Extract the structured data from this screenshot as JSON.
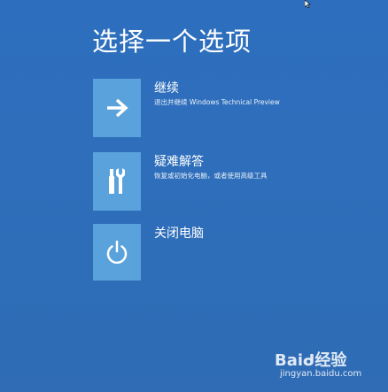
{
  "page": {
    "title": "选择一个选项"
  },
  "options": [
    {
      "label": "继续",
      "description": "退出并继续 Windows Technical Preview",
      "icon": "arrow-right-icon"
    },
    {
      "label": "疑难解答",
      "description": "恢复或初始化电脑，或者使用高级工具",
      "icon": "tools-icon"
    },
    {
      "label": "关闭电脑",
      "description": "",
      "icon": "power-icon"
    }
  ],
  "watermark": {
    "line1": "Baiᑯ经验",
    "line2": "jingyan.baidu.com"
  },
  "colors": {
    "background": "#2f6fba",
    "tile": "#5aa2dc",
    "text": "#ffffff"
  }
}
